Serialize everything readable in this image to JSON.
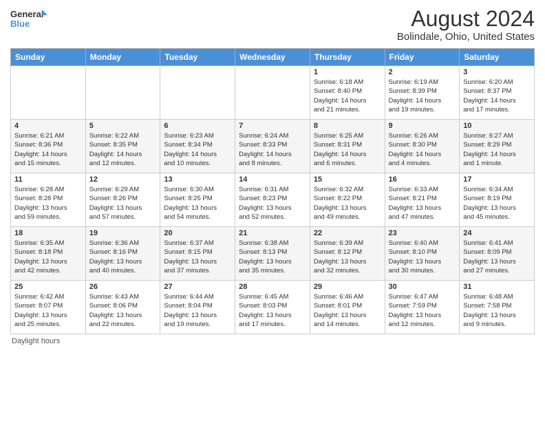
{
  "logo": {
    "line1": "General",
    "line2": "Blue"
  },
  "title": "August 2024",
  "subtitle": "Bolindale, Ohio, United States",
  "days_of_week": [
    "Sunday",
    "Monday",
    "Tuesday",
    "Wednesday",
    "Thursday",
    "Friday",
    "Saturday"
  ],
  "footer": "Daylight hours",
  "weeks": [
    [
      {
        "day": "",
        "info": ""
      },
      {
        "day": "",
        "info": ""
      },
      {
        "day": "",
        "info": ""
      },
      {
        "day": "",
        "info": ""
      },
      {
        "day": "1",
        "info": "Sunrise: 6:18 AM\nSunset: 8:40 PM\nDaylight: 14 hours\nand 21 minutes."
      },
      {
        "day": "2",
        "info": "Sunrise: 6:19 AM\nSunset: 8:39 PM\nDaylight: 14 hours\nand 19 minutes."
      },
      {
        "day": "3",
        "info": "Sunrise: 6:20 AM\nSunset: 8:37 PM\nDaylight: 14 hours\nand 17 minutes."
      }
    ],
    [
      {
        "day": "4",
        "info": "Sunrise: 6:21 AM\nSunset: 8:36 PM\nDaylight: 14 hours\nand 15 minutes."
      },
      {
        "day": "5",
        "info": "Sunrise: 6:22 AM\nSunset: 8:35 PM\nDaylight: 14 hours\nand 12 minutes."
      },
      {
        "day": "6",
        "info": "Sunrise: 6:23 AM\nSunset: 8:34 PM\nDaylight: 14 hours\nand 10 minutes."
      },
      {
        "day": "7",
        "info": "Sunrise: 6:24 AM\nSunset: 8:33 PM\nDaylight: 14 hours\nand 8 minutes."
      },
      {
        "day": "8",
        "info": "Sunrise: 6:25 AM\nSunset: 8:31 PM\nDaylight: 14 hours\nand 6 minutes."
      },
      {
        "day": "9",
        "info": "Sunrise: 6:26 AM\nSunset: 8:30 PM\nDaylight: 14 hours\nand 4 minutes."
      },
      {
        "day": "10",
        "info": "Sunrise: 6:27 AM\nSunset: 8:29 PM\nDaylight: 14 hours\nand 1 minute."
      }
    ],
    [
      {
        "day": "11",
        "info": "Sunrise: 6:28 AM\nSunset: 8:28 PM\nDaylight: 13 hours\nand 59 minutes."
      },
      {
        "day": "12",
        "info": "Sunrise: 6:29 AM\nSunset: 8:26 PM\nDaylight: 13 hours\nand 57 minutes."
      },
      {
        "day": "13",
        "info": "Sunrise: 6:30 AM\nSunset: 8:25 PM\nDaylight: 13 hours\nand 54 minutes."
      },
      {
        "day": "14",
        "info": "Sunrise: 6:31 AM\nSunset: 8:23 PM\nDaylight: 13 hours\nand 52 minutes."
      },
      {
        "day": "15",
        "info": "Sunrise: 6:32 AM\nSunset: 8:22 PM\nDaylight: 13 hours\nand 49 minutes."
      },
      {
        "day": "16",
        "info": "Sunrise: 6:33 AM\nSunset: 8:21 PM\nDaylight: 13 hours\nand 47 minutes."
      },
      {
        "day": "17",
        "info": "Sunrise: 6:34 AM\nSunset: 8:19 PM\nDaylight: 13 hours\nand 45 minutes."
      }
    ],
    [
      {
        "day": "18",
        "info": "Sunrise: 6:35 AM\nSunset: 8:18 PM\nDaylight: 13 hours\nand 42 minutes."
      },
      {
        "day": "19",
        "info": "Sunrise: 6:36 AM\nSunset: 8:16 PM\nDaylight: 13 hours\nand 40 minutes."
      },
      {
        "day": "20",
        "info": "Sunrise: 6:37 AM\nSunset: 8:15 PM\nDaylight: 13 hours\nand 37 minutes."
      },
      {
        "day": "21",
        "info": "Sunrise: 6:38 AM\nSunset: 8:13 PM\nDaylight: 13 hours\nand 35 minutes."
      },
      {
        "day": "22",
        "info": "Sunrise: 6:39 AM\nSunset: 8:12 PM\nDaylight: 13 hours\nand 32 minutes."
      },
      {
        "day": "23",
        "info": "Sunrise: 6:40 AM\nSunset: 8:10 PM\nDaylight: 13 hours\nand 30 minutes."
      },
      {
        "day": "24",
        "info": "Sunrise: 6:41 AM\nSunset: 8:09 PM\nDaylight: 13 hours\nand 27 minutes."
      }
    ],
    [
      {
        "day": "25",
        "info": "Sunrise: 6:42 AM\nSunset: 8:07 PM\nDaylight: 13 hours\nand 25 minutes."
      },
      {
        "day": "26",
        "info": "Sunrise: 6:43 AM\nSunset: 8:06 PM\nDaylight: 13 hours\nand 22 minutes."
      },
      {
        "day": "27",
        "info": "Sunrise: 6:44 AM\nSunset: 8:04 PM\nDaylight: 13 hours\nand 19 minutes."
      },
      {
        "day": "28",
        "info": "Sunrise: 6:45 AM\nSunset: 8:03 PM\nDaylight: 13 hours\nand 17 minutes."
      },
      {
        "day": "29",
        "info": "Sunrise: 6:46 AM\nSunset: 8:01 PM\nDaylight: 13 hours\nand 14 minutes."
      },
      {
        "day": "30",
        "info": "Sunrise: 6:47 AM\nSunset: 7:59 PM\nDaylight: 13 hours\nand 12 minutes."
      },
      {
        "day": "31",
        "info": "Sunrise: 6:48 AM\nSunset: 7:58 PM\nDaylight: 13 hours\nand 9 minutes."
      }
    ]
  ]
}
